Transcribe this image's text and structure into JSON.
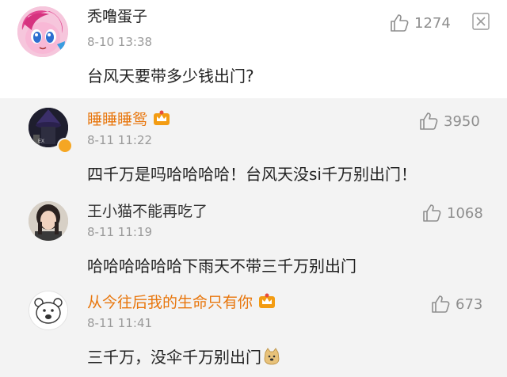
{
  "comments": [
    {
      "username": "秃噜蛋子",
      "time": "8-10 13:38",
      "text": "台风天要带多少钱出门?",
      "likes": "1274",
      "avatar_icon": "pink-pony-avatar",
      "has_close": true
    },
    {
      "username": "睡睡睡鸳",
      "time": "8-11 11:22",
      "text": "四千万是吗哈哈哈哈！台风天没si千万别出门！",
      "likes": "3950",
      "avatar_icon": "dark-wizard-avatar",
      "vip_badge": true,
      "verified_badge": true,
      "name_color": "#e8760c"
    },
    {
      "username": "王小猫不能再吃了",
      "time": "8-11 11:19",
      "text": "哈哈哈哈哈哈下雨天不带三千万别出门",
      "likes": "1068",
      "avatar_icon": "girl-photo-avatar"
    },
    {
      "username": "从今往后我的生命只有你",
      "time": "8-11 11:41",
      "text": "三千万，没伞千万别出门",
      "likes": "673",
      "avatar_icon": "cartoon-bear-avatar",
      "vip_badge": true,
      "emoji": "doge-emoji",
      "name_color": "#e8760c"
    }
  ],
  "colors": {
    "orange_name": "#e8760c",
    "sub_background": "#f3f3f3",
    "muted_text": "#9a9a9a"
  }
}
